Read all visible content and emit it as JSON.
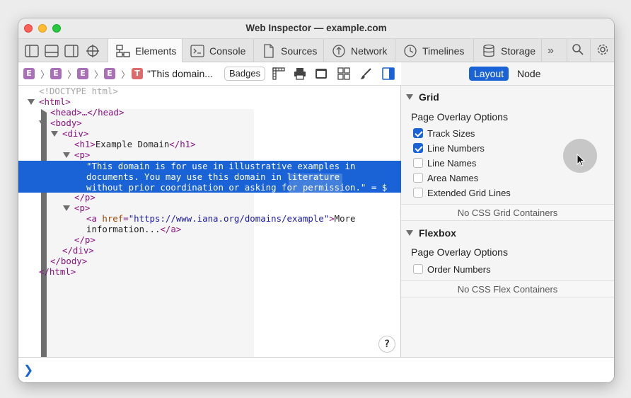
{
  "window": {
    "title": "Web Inspector — example.com"
  },
  "tabs": [
    {
      "label": "Elements",
      "icon": "elements-icon",
      "active": true
    },
    {
      "label": "Console",
      "icon": "console-icon"
    },
    {
      "label": "Sources",
      "icon": "sources-icon"
    },
    {
      "label": "Network",
      "icon": "network-icon"
    },
    {
      "label": "Timelines",
      "icon": "timelines-icon"
    },
    {
      "label": "Storage",
      "icon": "storage-icon"
    }
  ],
  "breadcrumb": {
    "element_letter": "E",
    "text_letter": "T",
    "text_node": "\"This domain...",
    "badges_label": "Badges"
  },
  "dom": {
    "doctype": "<!DOCTYPE html>",
    "html_open": "<html>",
    "head": "<head>…</head>",
    "body_open": "<body>",
    "div_open": "<div>",
    "h1_open": "<h1>",
    "h1_text": "Example Domain",
    "h1_close": "</h1>",
    "p_open": "<p>",
    "selected_text_1": "\"This domain is for use in illustrative examples in",
    "selected_text_2": "documents. You may use this domain in literature",
    "selected_text_3": "without prior coordination or asking for permission.\" = $",
    "p_close": "</p>",
    "a_open": "<a ",
    "a_attr": "href",
    "a_eq": "=",
    "a_val": "\"https://www.iana.org/domains/example\"",
    "a_gt": ">",
    "a_text_1": "More",
    "a_text_2": "information...",
    "a_close": "</a>",
    "div_close": "</div>",
    "body_close": "</body>",
    "html_close": "</html>"
  },
  "help": {
    "label": "?"
  },
  "right": {
    "tabs": {
      "layout": "Layout",
      "node": "Node"
    },
    "grid": {
      "title": "Grid",
      "subtitle": "Page Overlay Options",
      "options": [
        {
          "label": "Track Sizes",
          "checked": true
        },
        {
          "label": "Line Numbers",
          "checked": true
        },
        {
          "label": "Line Names",
          "checked": false
        },
        {
          "label": "Area Names",
          "checked": false
        },
        {
          "label": "Extended Grid Lines",
          "checked": false
        }
      ],
      "empty": "No CSS Grid Containers"
    },
    "flexbox": {
      "title": "Flexbox",
      "subtitle": "Page Overlay Options",
      "options": [
        {
          "label": "Order Numbers",
          "checked": false
        }
      ],
      "empty": "No CSS Flex Containers"
    }
  },
  "console": {
    "prompt": "❯"
  },
  "colors": {
    "accent": "#1a63d6",
    "tag": "#881280",
    "attr": "#994500",
    "value": "#1a1aa6",
    "element_badge": "#a96fb7",
    "text_badge": "#de6b6b"
  }
}
